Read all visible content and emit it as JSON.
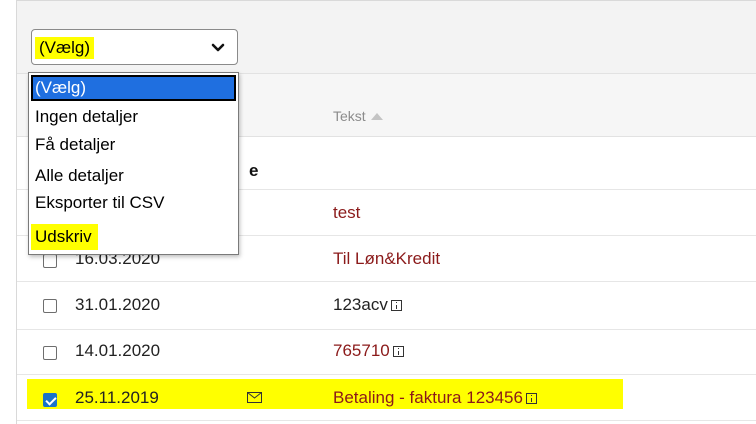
{
  "dropdown": {
    "selected_value": "(Vælg)",
    "options": [
      "(Vælg)",
      "Ingen detaljer",
      "Få detaljer",
      "Alle detaljer",
      "Eksporter til CSV",
      "Udskriv"
    ]
  },
  "table": {
    "column_header": "Tekst",
    "group_label": "e",
    "rows": [
      {
        "date": "",
        "text": "test",
        "checked": false
      },
      {
        "date": "16.03.2020",
        "text": "Til Løn&Kredit",
        "checked": false
      },
      {
        "date": "31.01.2020",
        "text": "123acv",
        "checked": false
      },
      {
        "date": "14.01.2020",
        "text": "765710",
        "checked": false
      },
      {
        "date": "25.11.2019",
        "text": "Betaling - faktura 123456",
        "checked": true
      }
    ]
  },
  "icons": {
    "chevron": "chevron-down-icon",
    "sort": "sort-ascending-icon",
    "info": "info-icon",
    "mail": "mail-icon"
  },
  "colors": {
    "highlight": "#ffff00",
    "option_selected": "#1f6fe0",
    "link_text": "#8b1a1a",
    "checkbox_checked": "#1a73c8"
  }
}
